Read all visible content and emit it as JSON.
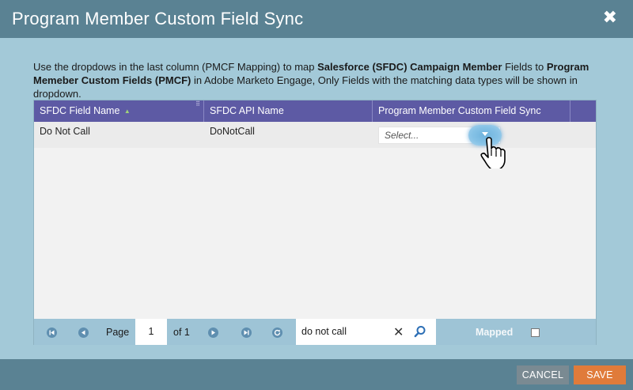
{
  "dialog": {
    "title": "Program Member Custom Field Sync",
    "close_label": "✖"
  },
  "instructions": {
    "part1": "Use the dropdows in the last column (PMCF Mapping) to map ",
    "bold1": "Salesforce (SFDC) Campaign Member",
    "part2": " Fields to ",
    "bold2": "Program Memeber Custom Fields (PMCF)",
    "part3": " in Adobe Marketo Engage, Only Fields with the matching data types will be shown in dropdown."
  },
  "grid": {
    "columns": [
      "SFDC Field Name",
      "SFDC API Name",
      "Program Member Custom Field Sync"
    ],
    "rows": [
      {
        "field_name": "Do Not Call",
        "api_name": "DoNotCall",
        "select_placeholder": "Select..."
      }
    ]
  },
  "pager": {
    "page_label": "Page",
    "page_value": "1",
    "of_label": "of 1",
    "search_value": "do not call",
    "mapped_label": "Mapped"
  },
  "footer": {
    "cancel_label": "CANCEL",
    "save_label": "SAVE"
  },
  "icons": {
    "close": "close-icon",
    "sort": "sort-asc-icon",
    "first": "first-page-icon",
    "prev": "prev-page-icon",
    "next": "next-page-icon",
    "last": "last-page-icon",
    "refresh": "refresh-icon",
    "clear": "clear-icon",
    "search": "search-icon",
    "cursor": "hand-cursor-icon"
  },
  "colors": {
    "header_bg": "#5a8293",
    "grid_header_bg": "#5d5aa4",
    "save_bg": "#e07b3a",
    "cancel_bg": "#7a8a92"
  }
}
